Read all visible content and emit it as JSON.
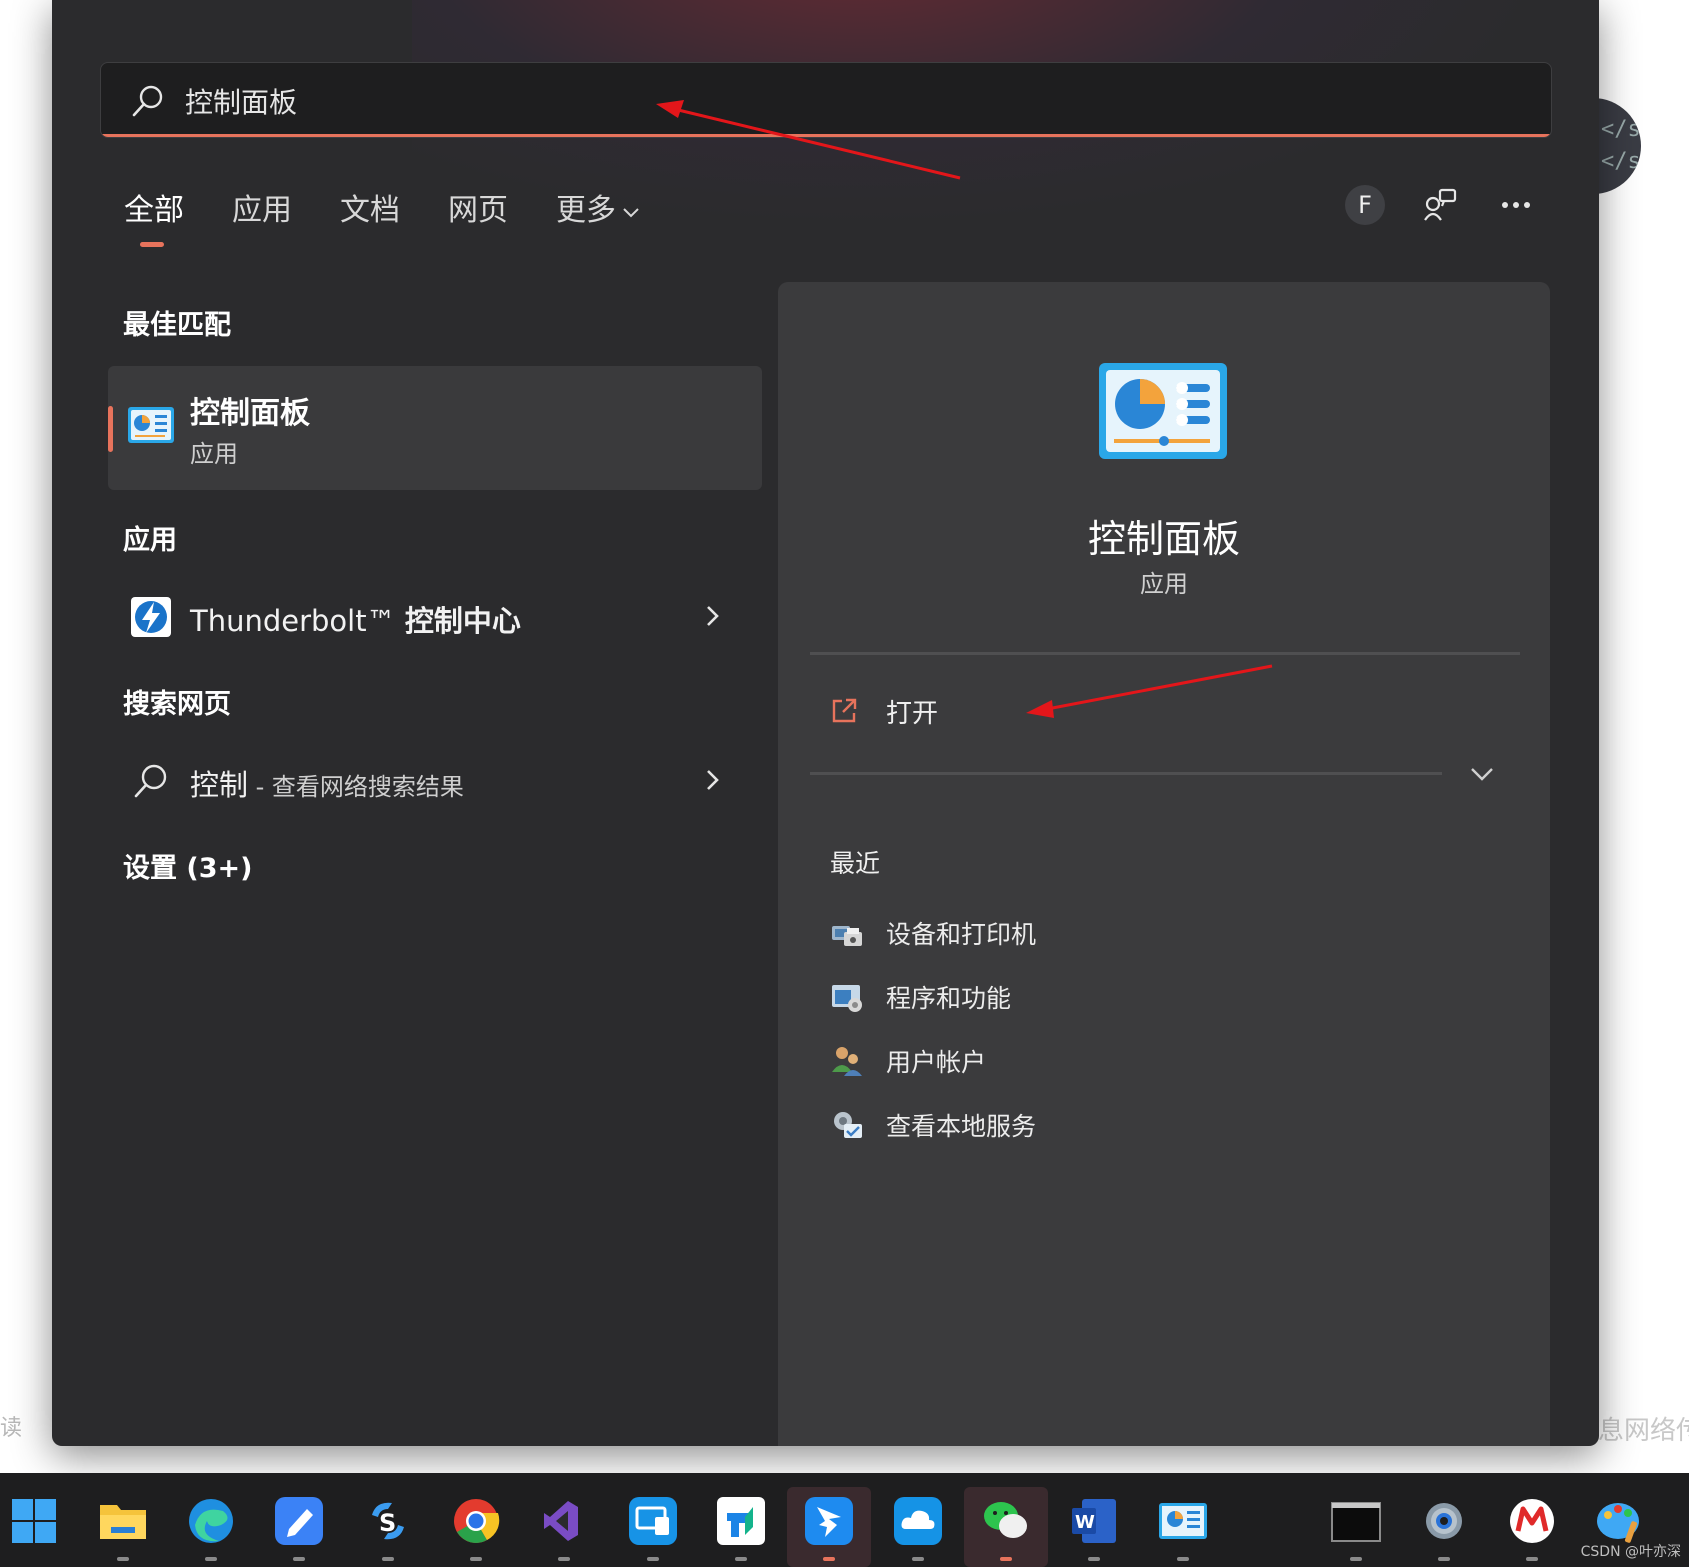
{
  "search": {
    "query": "控制面板",
    "placeholder": ""
  },
  "tabs": [
    {
      "label": "全部",
      "active": true
    },
    {
      "label": "应用",
      "active": false
    },
    {
      "label": "文档",
      "active": false
    },
    {
      "label": "网页",
      "active": false
    },
    {
      "label": "更多",
      "active": false
    }
  ],
  "top_actions": {
    "avatar_letter": "F",
    "icons": [
      "share-feedback-icon",
      "more-icon"
    ]
  },
  "left": {
    "best_match_title": "最佳匹配",
    "best_match": {
      "name": "控制面板",
      "type": "应用",
      "icon": "control-panel-icon"
    },
    "apps_title": "应用",
    "apps": [
      {
        "name_prefix": "Thunderbolt™ ",
        "name_bold": "控制中心",
        "icon": "thunderbolt-icon"
      }
    ],
    "web_title": "搜索网页",
    "web": [
      {
        "query": "控制",
        "suffix": " - 查看网络搜索结果",
        "icon": "search-icon"
      }
    ],
    "settings_title": "设置 (3+)"
  },
  "right": {
    "name": "控制面板",
    "type": "应用",
    "open_label": "打开",
    "recent_title": "最近",
    "recent": [
      {
        "label": "设备和打印机",
        "icon": "devices-printers-icon"
      },
      {
        "label": "程序和功能",
        "icon": "programs-features-icon"
      },
      {
        "label": "用户帐户",
        "icon": "user-accounts-icon"
      },
      {
        "label": "查看本地服务",
        "icon": "local-services-icon"
      }
    ]
  },
  "background": {
    "left_text": "读",
    "right_text": "息网络传",
    "disk_lines": [
      "</s",
      "</s"
    ]
  },
  "taskbar": {
    "apps": [
      "windows-start-icon",
      "file-explorer-icon",
      "edge-icon",
      "pen-app-icon",
      "sync-app-icon",
      "chrome-icon",
      "visual-studio-icon",
      "remote-desktop-icon",
      "teamviewer-icon",
      "dingtalk-icon",
      "cloud-app-icon",
      "wechat-icon",
      "word-icon",
      "control-panel-icon",
      "terminal-icon",
      "settings-icon",
      "m-app-icon",
      "paint-icon"
    ],
    "watermark": "CSDN @叶亦深"
  },
  "colors": {
    "accent": "#e7735c",
    "panel": "#2b2b2d",
    "pane": "#3b3b3d",
    "annotation_arrow": "#e3161a"
  }
}
